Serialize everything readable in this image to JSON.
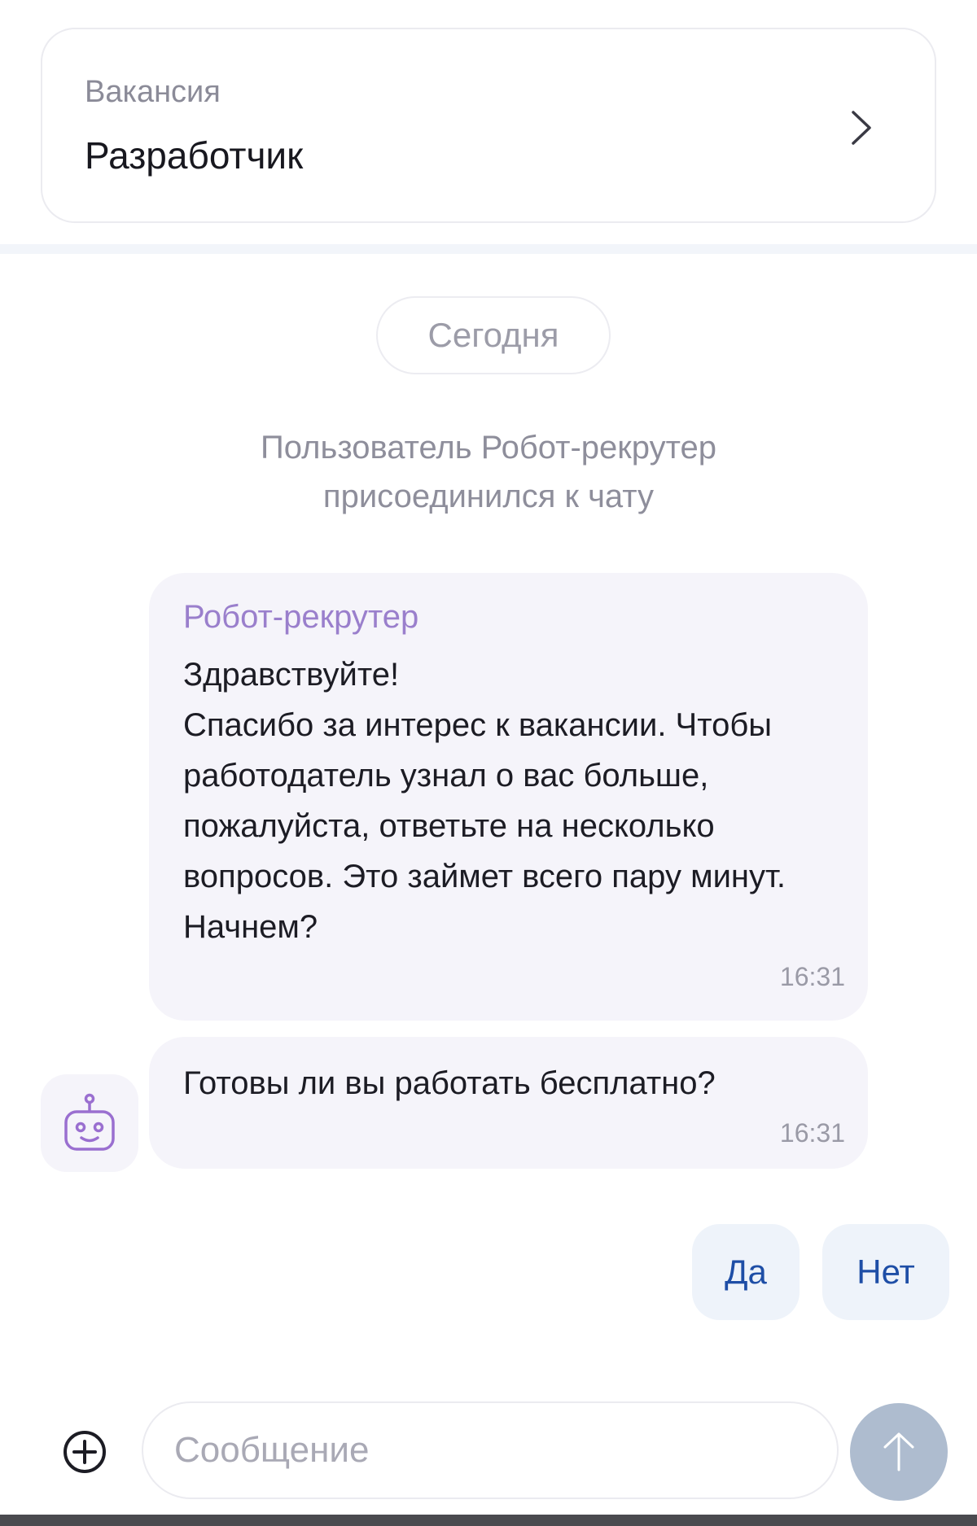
{
  "vacancy": {
    "label": "Вакансия",
    "title": "Разработчик",
    "chevron_icon": "chevron-right-icon"
  },
  "chat": {
    "date_label": "Сегодня",
    "system_message": "Пользователь Робот-рекрутер присоединился к чату",
    "messages": [
      {
        "sender": "Робот-рекрутер",
        "text": "Здравствуйте!\nСпасибо за интерес к вакансии. Чтобы работодатель узнал о вас больше, пожалуйста, ответьте на несколько вопросов. Это займет всего пару минут.\nНачнем?",
        "time": "16:31"
      },
      {
        "text": "Готовы ли вы работать бесплатно?",
        "time": "16:31"
      }
    ],
    "avatar_icon": "robot-icon",
    "quick_replies": [
      "Да",
      "Нет"
    ]
  },
  "composer": {
    "placeholder": "Сообщение",
    "value": "",
    "attach_icon": "plus-circle-icon",
    "send_icon": "arrow-up-icon"
  },
  "colors": {
    "accent": "#1e4ea6",
    "sender_name": "#9a7fcc",
    "bubble_bg": "#f5f4fa",
    "reply_bg": "#eef3fa",
    "send_button": "#aebccf"
  }
}
